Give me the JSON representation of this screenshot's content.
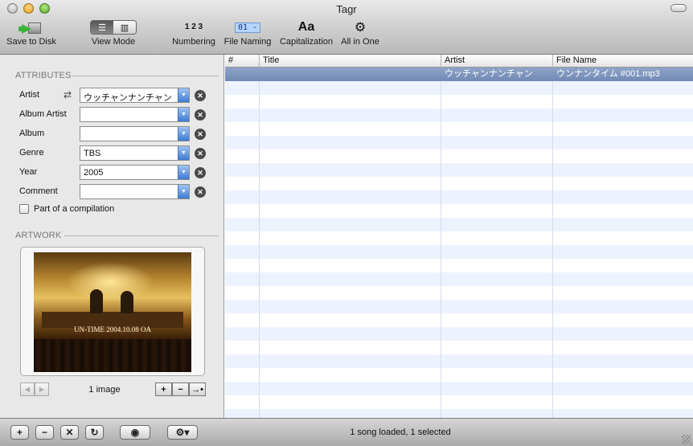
{
  "window": {
    "title": "Tagr"
  },
  "toolbar": {
    "save_label": "Save to Disk",
    "view_mode_label": "View Mode",
    "numbering_label": "Numbering",
    "numbering_glyph": "1 2 3",
    "file_naming_label": "File Naming",
    "file_naming_glyph": "01 -",
    "capitalization_label": "Capitalization",
    "capitalization_glyph": "Aa",
    "all_in_one_label": "All in One"
  },
  "attributes": {
    "heading": "ATTRIBUTES",
    "fields": [
      {
        "label": "Artist",
        "value": "ウッチャンナンチャン"
      },
      {
        "label": "Album Artist",
        "value": ""
      },
      {
        "label": "Album",
        "value": ""
      },
      {
        "label": "Genre",
        "value": "TBS"
      },
      {
        "label": "Year",
        "value": "2005"
      },
      {
        "label": "Comment",
        "value": ""
      }
    ],
    "compilation_label": "Part of a compilation",
    "compilation_checked": false
  },
  "artwork": {
    "heading": "ARTWORK",
    "caption": "UN-TIME 2004.10.08 OA",
    "count_label": "1 image"
  },
  "table": {
    "columns": [
      "#",
      "Title",
      "Artist",
      "File Name"
    ],
    "rows": [
      {
        "number": "",
        "title": "",
        "artist": "ウッチャンナンチャン",
        "file_name": "ウンナンタイム #001.mp3",
        "selected": true
      }
    ]
  },
  "status": {
    "text": "1 song loaded, 1 selected"
  },
  "colors": {
    "selection": "#7f96bf",
    "stripe": "#edf3fe",
    "dropdown_accent": "#3c7bd4"
  }
}
